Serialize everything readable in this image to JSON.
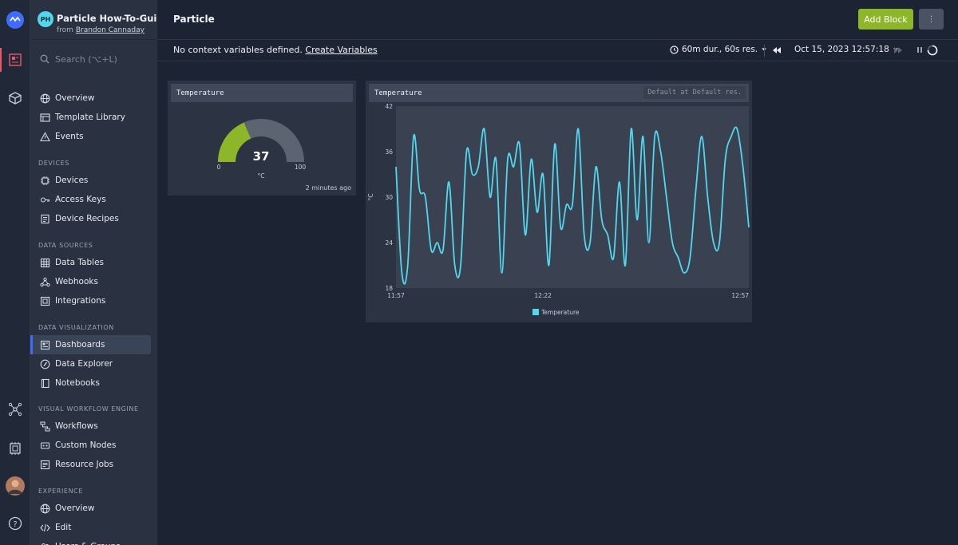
{
  "colors": {
    "accent": "#8db628",
    "series": "#4fd8ee",
    "gauge_fill": "#8db628",
    "gauge_rest": "#5d6471",
    "active_indicator": "#3d6cff"
  },
  "rail": {
    "icons": [
      "particle-logo-icon",
      "console-icon",
      "cube-icon",
      "network-icon",
      "chip-icon",
      "user-avatar",
      "help-icon"
    ]
  },
  "org": {
    "initials": "PH",
    "name": "Particle How-To-Guide",
    "from_label": "from",
    "owner": "Brandon Cannaday"
  },
  "search": {
    "placeholder": "Search (⌥+L)"
  },
  "sidebar": {
    "top_items": [
      {
        "label": "Overview",
        "icon": "globe-icon"
      },
      {
        "label": "Template Library",
        "icon": "library-icon"
      },
      {
        "label": "Events",
        "icon": "warning-icon"
      }
    ],
    "sections": [
      {
        "label": "DEVICES",
        "items": [
          {
            "label": "Devices",
            "icon": "chip-icon"
          },
          {
            "label": "Access Keys",
            "icon": "key-icon"
          },
          {
            "label": "Device Recipes",
            "icon": "recipe-icon"
          }
        ]
      },
      {
        "label": "DATA SOURCES",
        "items": [
          {
            "label": "Data Tables",
            "icon": "table-icon"
          },
          {
            "label": "Webhooks",
            "icon": "webhook-icon"
          },
          {
            "label": "Integrations",
            "icon": "integration-icon"
          }
        ]
      },
      {
        "label": "DATA VISUALIZATION",
        "items": [
          {
            "label": "Dashboards",
            "icon": "dashboard-icon",
            "active": true
          },
          {
            "label": "Data Explorer",
            "icon": "explorer-icon"
          },
          {
            "label": "Notebooks",
            "icon": "notebook-icon"
          }
        ]
      },
      {
        "label": "VISUAL WORKFLOW ENGINE",
        "items": [
          {
            "label": "Workflows",
            "icon": "workflow-icon"
          },
          {
            "label": "Custom Nodes",
            "icon": "custom-node-icon"
          },
          {
            "label": "Resource Jobs",
            "icon": "resource-jobs-icon"
          }
        ]
      },
      {
        "label": "EXPERIENCE",
        "items": [
          {
            "label": "Overview",
            "icon": "globe-icon"
          },
          {
            "label": "Edit",
            "icon": "code-icon"
          },
          {
            "label": "Users & Groups",
            "icon": "users-icon"
          }
        ]
      }
    ]
  },
  "header": {
    "title": "Particle",
    "add_block_label": "Add Block",
    "more_label": "⋮"
  },
  "toolbar": {
    "context_text": "No context variables defined.",
    "create_variables_label": "Create Variables",
    "duration_label": "60m dur., 60s res.",
    "timestamp": "Oct 15, 2023 12:57:18"
  },
  "gauge_block": {
    "title": "Temperature",
    "value": 37,
    "min": "0",
    "max": "100",
    "unit": "°C",
    "updated": "2 minutes ago",
    "fraction": 0.37
  },
  "line_block": {
    "title": "Temperature",
    "info": "Default at Default res."
  },
  "chart_data": {
    "type": "line",
    "title": "Temperature",
    "xlabel": "",
    "ylabel": "°C",
    "ylim": [
      18,
      42
    ],
    "yticks": [
      "18",
      "24",
      "30",
      "36",
      "42"
    ],
    "xticks": [
      {
        "label": "11:57",
        "x": 0
      },
      {
        "label": "12:22",
        "x": 25
      },
      {
        "label": "12:57",
        "x": 60
      }
    ],
    "grid": false,
    "legend": "bottom-center",
    "series": [
      {
        "name": "Temperature",
        "color": "#4fd8ee",
        "x": [
          0,
          1,
          2,
          3,
          4,
          5,
          6,
          7,
          8,
          9,
          10,
          11,
          12,
          13,
          14,
          15,
          16,
          17,
          18,
          19,
          20,
          21,
          22,
          23,
          24,
          25,
          26,
          27,
          28,
          29,
          30,
          31,
          32,
          33,
          34,
          35,
          36,
          37,
          38,
          39,
          40,
          41,
          42,
          43,
          44,
          45,
          46,
          47,
          48,
          49,
          50,
          51,
          52,
          53,
          54,
          55,
          56,
          57,
          58,
          59,
          60
        ],
        "values": [
          34,
          20,
          21,
          38,
          31,
          30,
          23,
          24,
          23,
          32,
          21,
          21,
          36,
          33,
          34,
          39,
          30,
          35,
          20,
          35,
          34,
          37,
          25,
          35,
          28,
          33,
          21,
          37,
          26,
          29,
          29,
          39,
          25,
          24,
          34,
          27,
          25,
          22,
          32,
          21,
          39,
          27,
          38,
          24,
          38,
          36,
          30,
          24,
          22,
          20,
          22,
          31,
          38,
          30,
          24,
          24,
          35,
          38,
          39,
          34,
          26
        ]
      }
    ]
  }
}
